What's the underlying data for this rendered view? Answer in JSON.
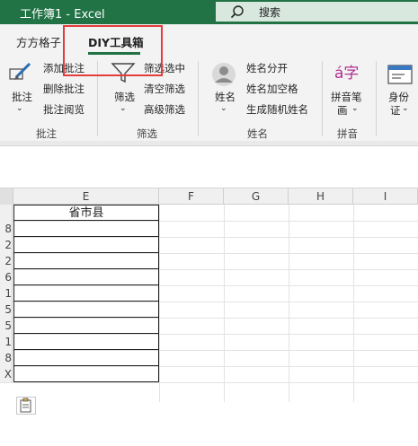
{
  "titlebar": {
    "title": "工作簿1  -  Excel",
    "search_label": "搜索",
    "bg_color": "#217346"
  },
  "tabs": [
    {
      "label": "方方格子"
    },
    {
      "label": "DIY工具箱",
      "active": true
    }
  ],
  "ribbon": {
    "groups": [
      {
        "name": "批注",
        "big_button": "批注",
        "items": [
          "添加批注",
          "删除批注",
          "批注阅览"
        ]
      },
      {
        "name": "筛选",
        "big_button": "筛选",
        "items": [
          "筛选选中",
          "清空筛选",
          "高级筛选"
        ]
      },
      {
        "name": "姓名",
        "big_button": "姓名",
        "items": [
          "姓名分开",
          "姓名加空格",
          "生成随机姓名"
        ]
      },
      {
        "name": "拼音",
        "big_button": "拼音笔画",
        "big_button_line1": "拼音笔",
        "big_button_line2": "画"
      },
      {
        "big_button_line1": "身份",
        "big_button_line2": "证"
      }
    ],
    "pinyin_icon_text": "á字"
  },
  "sheet": {
    "columns": [
      "E",
      "F",
      "G",
      "H",
      "I"
    ],
    "header_cell": "省市县",
    "row_heads": [
      "8",
      "2",
      "2",
      "6",
      "1",
      "5",
      "5",
      "1",
      "8",
      "X"
    ]
  },
  "accent_color": "#217346",
  "highlight_color": "#e43b3b"
}
